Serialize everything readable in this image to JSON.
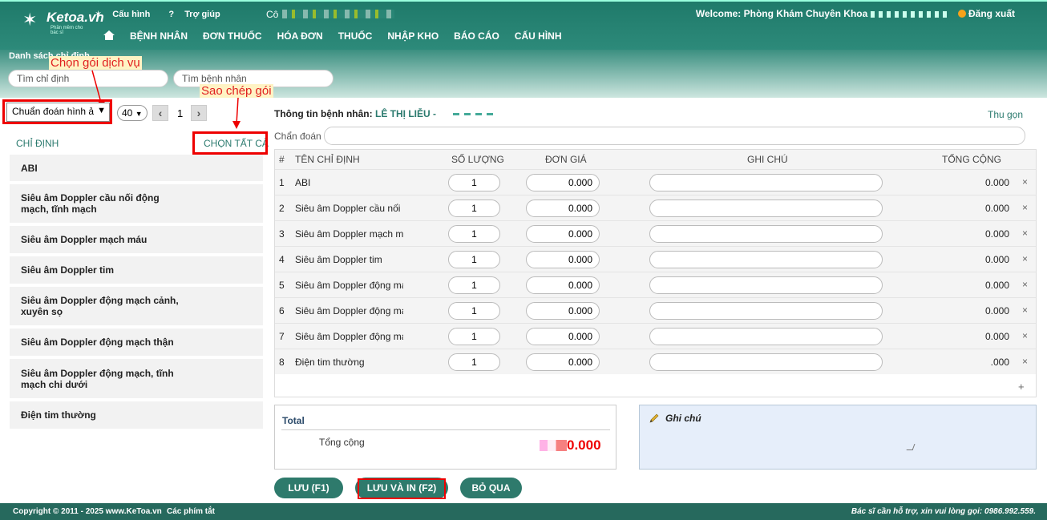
{
  "header": {
    "logo_text": "Ketoa.vn",
    "logo_tagline": "Phần mềm cho bác sĩ",
    "config_link": "Cấu hình",
    "help_link": "Trợ giúp",
    "co_label": "Cô",
    "welcome": "Welcome: Phòng Khám Chuyên Khoa",
    "logout": "Đăng xuất",
    "nav": [
      "BỆNH NHÂN",
      "ĐƠN THUỐC",
      "HÓA ĐƠN",
      "THUỐC",
      "NHẬP KHO",
      "BÁO CÁO",
      "CẤU HÌNH"
    ]
  },
  "subheader": {
    "title": "Danh sách chỉ định",
    "search_indication": "Tìm chỉ định",
    "search_patient": "Tìm bệnh nhân"
  },
  "annotations": {
    "choose_package": "Chọn gói dịch vụ",
    "copy_package": "Sao chép gói"
  },
  "left": {
    "package_select": "Chuẩn đoán hình ả",
    "page_size": "40",
    "page": "1",
    "column_label": "CHỈ ĐỊNH",
    "select_all": "CHỌN TẤT CẢ",
    "items": [
      "ABI",
      "Siêu âm Doppler cầu nối động mạch, tĩnh mạch",
      "Siêu âm Doppler mạch máu",
      "Siêu âm Doppler tim",
      "Siêu âm Doppler động mạch cảnh, xuyên sọ",
      "Siêu âm Doppler động mạch thận",
      "Siêu âm Doppler động mạch, tĩnh mạch chi dưới",
      "Điện tim thường"
    ]
  },
  "patient": {
    "label": "Thông tin bệnh nhân:",
    "name": "LÊ THỊ LIỄU -",
    "collapse": "Thu gọn",
    "diagnosis_label": "Chẩn đoán :"
  },
  "table": {
    "headers": [
      "#",
      "TÊN CHỈ ĐỊNH",
      "SỐ LƯỢNG",
      "ĐƠN GIÁ",
      "GHI CHÚ",
      "TỔNG CỘNG"
    ],
    "rows": [
      {
        "idx": "1",
        "name": "ABI",
        "qty": "1",
        "price": "0.000",
        "total": "0.000"
      },
      {
        "idx": "2",
        "name": "Siêu âm Doppler cầu nối động mạch, tĩnh mạch",
        "qty": "1",
        "price": "0.000",
        "total": "0.000"
      },
      {
        "idx": "3",
        "name": "Siêu âm Doppler mạch máu",
        "qty": "1",
        "price": "0.000",
        "total": "0.000"
      },
      {
        "idx": "4",
        "name": "Siêu âm Doppler tim",
        "qty": "1",
        "price": "0.000",
        "total": "0.000"
      },
      {
        "idx": "5",
        "name": "Siêu âm Doppler động mạch cảnh, xuyên sọ",
        "qty": "1",
        "price": "0.000",
        "total": "0.000"
      },
      {
        "idx": "6",
        "name": "Siêu âm Doppler động mạch thận",
        "qty": "1",
        "price": "0.000",
        "total": "0.000"
      },
      {
        "idx": "7",
        "name": "Siêu âm Doppler động mạch, tĩnh mạch chi dưới",
        "qty": "1",
        "price": "0.000",
        "total": "0.000"
      },
      {
        "idx": "8",
        "name": "Điện tim thường",
        "qty": "1",
        "price": "0.000",
        "total": ".000"
      }
    ],
    "delete_symbol": "×",
    "add_symbol": "+"
  },
  "summary": {
    "title": "Total",
    "label": "Tổng cộng",
    "value": "0.000"
  },
  "notes": {
    "title": "Ghi chú"
  },
  "buttons": {
    "save": "LƯU (F1)",
    "save_print": "LƯU VÀ IN (F2)",
    "skip": "BỎ QUA"
  },
  "footer": {
    "copyright": "Copyright © 2011 - 2025 www.KeToa.vn",
    "shortcuts": "Các phím tắt",
    "support": "Bác sĩ cần hỗ trợ, xin vui lòng gọi: 0986.992.559."
  },
  "colors": {
    "primary": "#2e7a6c",
    "accent_text": "#2b7a6e",
    "total_red": "#e00000",
    "annotation_red": "#e02020"
  }
}
